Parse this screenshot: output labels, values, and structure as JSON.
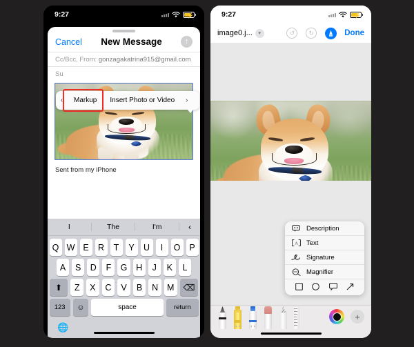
{
  "left_phone": {
    "status": {
      "time": "9:27",
      "wifi_icon": "wifi-icon",
      "battery_icon": "battery-charging-icon"
    },
    "mail": {
      "cancel_label": "Cancel",
      "title": "New Message",
      "send_icon": "send-arrow-up-icon",
      "cc_label": "Cc/Bcc, From:",
      "from_address": "gonzagakatrina915@gmail.com",
      "subject_label": "Su",
      "body_signature": "Sent from my iPhone",
      "popup": {
        "prev_icon": "chevron-left-icon",
        "items": [
          {
            "label": "Markup",
            "highlighted": true
          },
          {
            "label": "Insert Photo or Video",
            "highlighted": false
          }
        ],
        "next_icon": "chevron-right-icon"
      },
      "attachment_alt": "corgi-dog-photo"
    },
    "keyboard": {
      "suggestions": [
        "I",
        "The",
        "I'm"
      ],
      "suggestion_chevron": "chevron-left-icon",
      "row1": [
        "Q",
        "W",
        "E",
        "R",
        "T",
        "Y",
        "U",
        "I",
        "O",
        "P"
      ],
      "row2": [
        "A",
        "S",
        "D",
        "F",
        "G",
        "H",
        "J",
        "K",
        "L"
      ],
      "row3_shift": "shift-icon",
      "row3": [
        "Z",
        "X",
        "C",
        "V",
        "B",
        "N",
        "M"
      ],
      "row3_delete": "delete-backspace-icon",
      "numbers_key": "123",
      "emoji_key": "emoji-smiley-icon",
      "space_key": "space",
      "return_key": "return",
      "globe_key": "globe-icon"
    }
  },
  "right_phone": {
    "status": {
      "time": "9:27",
      "wifi_icon": "wifi-icon",
      "battery_icon": "battery-charging-icon"
    },
    "editor": {
      "filename": "image0.j...",
      "filename_chevron": "chevron-down-icon",
      "undo_icon": "undo-arrow-icon",
      "redo_icon": "redo-arrow-icon",
      "markup_icon": "markup-pen-icon",
      "done_label": "Done",
      "photo_alt": "corgi-dog-photo"
    },
    "markup_menu": {
      "items": [
        {
          "label": "Description",
          "icon": "description-bubble-icon",
          "highlighted": false
        },
        {
          "label": "Text",
          "icon": "text-box-a-icon",
          "highlighted": true
        },
        {
          "label": "Signature",
          "icon": "signature-icon",
          "highlighted": false
        },
        {
          "label": "Magnifier",
          "icon": "magnifier-icon",
          "highlighted": false
        }
      ],
      "shapes": [
        "square-shape-icon",
        "circle-shape-icon",
        "speech-bubble-shape-icon",
        "arrow-shape-icon"
      ]
    },
    "toolbar": {
      "tools": [
        "pen-tool",
        "highlighter-tool",
        "marker-tool",
        "eraser-tool",
        "lasso-tool",
        "ruler-tool"
      ],
      "color_swatch": "#0d0d0d",
      "color_wheel_icon": "color-wheel-icon",
      "add_button_icon": "plus-icon"
    }
  },
  "annotations": {
    "highlight_color": "#ef2d24"
  }
}
